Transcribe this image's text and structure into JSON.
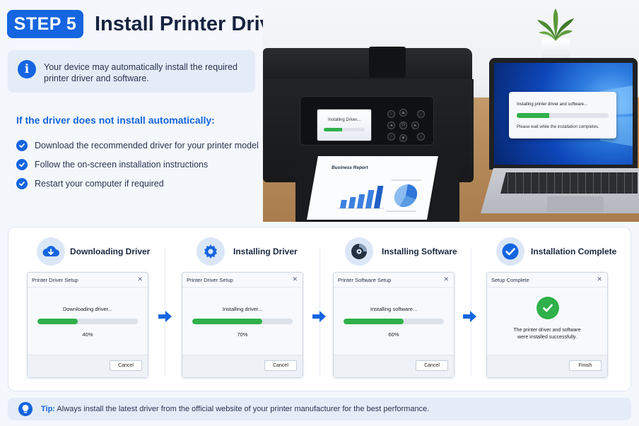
{
  "header": {
    "step_badge": "STEP 5",
    "title": "Install Printer Driver",
    "title_icon": "download-icon"
  },
  "info": {
    "icon": "info-icon",
    "text": "Your device may automatically install the required printer driver and software."
  },
  "manual": {
    "heading": "If the driver does not install automatically:",
    "items": [
      {
        "label": "Download the recommended driver for your printer model"
      },
      {
        "label": "Follow the on-screen installation instructions"
      },
      {
        "label": "Restart your computer if required"
      }
    ]
  },
  "scene": {
    "printer_screen_text": "Installing Driver...",
    "printer_progress": 0.45,
    "paper_title": "Business Report",
    "laptop_dialog_title": "Installing printer driver and software...",
    "laptop_dialog_sub": "Please wait while the installation completes.",
    "laptop_progress": 0.35
  },
  "steps": [
    {
      "label": "Downloading Driver",
      "icon": "cloud-download-icon",
      "dialog_title": "Printer Driver Setup",
      "status": "Downloading driver...",
      "progress": 0.4,
      "percent": "40%",
      "button": "Cancel"
    },
    {
      "label": "Installing Driver",
      "icon": "gear-icon",
      "dialog_title": "Printer Driver Setup",
      "status": "Installing driver...",
      "progress": 0.7,
      "percent": "70%",
      "button": "Cancel"
    },
    {
      "label": "Installing Software",
      "icon": "disc-icon",
      "dialog_title": "Printer Software Setup",
      "status": "Installing software...",
      "progress": 0.6,
      "percent": "60%",
      "button": "Cancel"
    },
    {
      "label": "Installation Complete",
      "icon": "check-circle-icon",
      "dialog_title": "Setup Complete",
      "message_line1": "The printer driver and software",
      "message_line2": "were installed successfully.",
      "button": "Finish"
    }
  ],
  "tip": {
    "label": "Tip:",
    "text": "Always install the latest driver from the official website of your printer manufacturer for the best performance.",
    "icon": "lightbulb-icon"
  },
  "colors": {
    "accent": "#1565e0",
    "success": "#2fb04a",
    "background": "#f4f7fc"
  }
}
